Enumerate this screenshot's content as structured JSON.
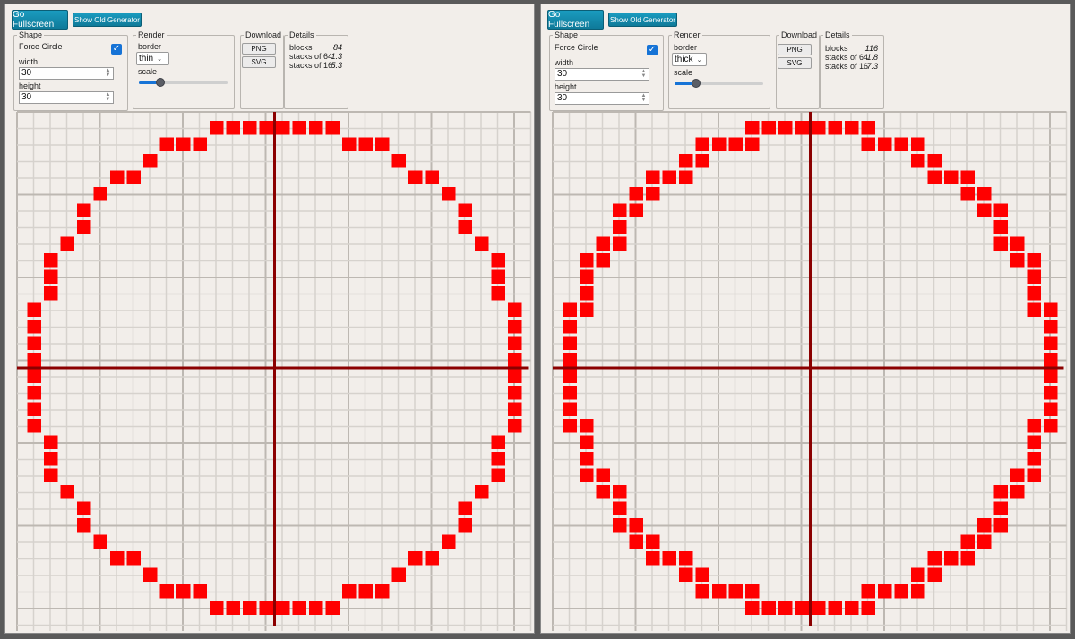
{
  "panels": [
    {
      "buttons": {
        "fullscreen": "Go Fullscreen",
        "old_generator": "Show Old Generator"
      },
      "shape": {
        "legend": "Shape",
        "force_circle_label": "Force Circle",
        "force_circle": true,
        "width_label": "width",
        "width_value": "30",
        "height_label": "height",
        "height_value": "30"
      },
      "render": {
        "legend": "Render",
        "border_label": "border",
        "border_value": "thin",
        "scale_label": "scale",
        "scale_fraction": 0.2
      },
      "download": {
        "legend": "Download",
        "png_label": "PNG",
        "svg_label": "SVG"
      },
      "details": {
        "legend": "Details",
        "rows": [
          {
            "label": "blocks",
            "value": "84"
          },
          {
            "label": "stacks of 64",
            "value": "1.3"
          },
          {
            "label": "stacks of 16",
            "value": "5.3"
          }
        ]
      },
      "circle": {
        "diameter": 30,
        "border": "thin"
      }
    },
    {
      "buttons": {
        "fullscreen": "Go Fullscreen",
        "old_generator": "Show Old Generator"
      },
      "shape": {
        "legend": "Shape",
        "force_circle_label": "Force Circle",
        "force_circle": true,
        "width_label": "width",
        "width_value": "30",
        "height_label": "height",
        "height_value": "30"
      },
      "render": {
        "legend": "Render",
        "border_label": "border",
        "border_value": "thick",
        "scale_label": "scale",
        "scale_fraction": 0.2
      },
      "download": {
        "legend": "Download",
        "png_label": "PNG",
        "svg_label": "SVG"
      },
      "details": {
        "legend": "Details",
        "rows": [
          {
            "label": "blocks",
            "value": "116"
          },
          {
            "label": "stacks of 64",
            "value": "1.8"
          },
          {
            "label": "stacks of 16",
            "value": "7.3"
          }
        ]
      },
      "circle": {
        "diameter": 30,
        "border": "thick"
      }
    }
  ],
  "colors": {
    "block": "#ff0000",
    "axis": "#8b0000",
    "grid_minor": "#d6d2cd",
    "grid_major": "#bdb8b2",
    "background": "#f2eeea",
    "accent": "#1673d6"
  }
}
